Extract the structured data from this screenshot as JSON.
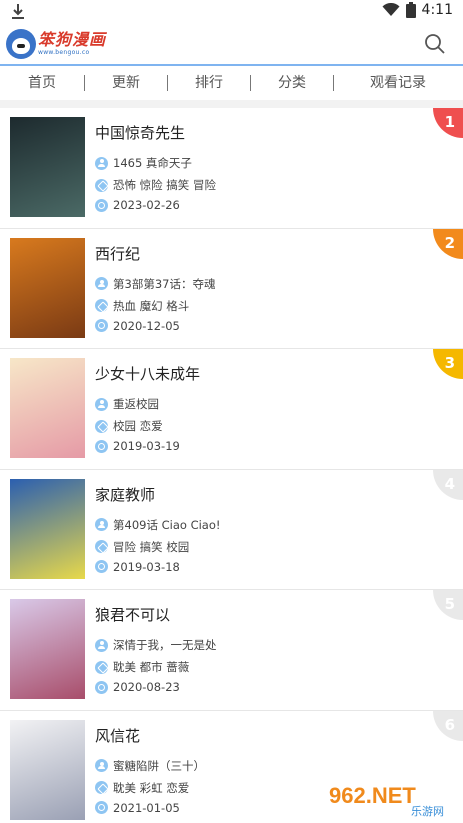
{
  "status_bar": {
    "time": "4:11"
  },
  "header": {
    "logo_name": "笨狗漫画",
    "logo_url": "www.bengou.co"
  },
  "nav": {
    "tabs": [
      {
        "label": "首页"
      },
      {
        "label": "更新"
      },
      {
        "label": "排行"
      },
      {
        "label": "分类"
      },
      {
        "label": "观看记录"
      }
    ]
  },
  "comics": [
    {
      "rank": "1",
      "rank_color": "#ef4f4f",
      "title": "中国惊奇先生",
      "author": "1465 真命天子",
      "tags": "恐怖 惊险 搞笑 冒险",
      "date": "2023-02-26",
      "cover_colors": [
        "#1d2a2e",
        "#4b6a66"
      ]
    },
    {
      "rank": "2",
      "rank_color": "#f28a1c",
      "title": "西行纪",
      "author": "第3部第37话：夺魂",
      "tags": "热血 魔幻 格斗",
      "date": "2020-12-05",
      "cover_colors": [
        "#d87a1e",
        "#7a3a14"
      ]
    },
    {
      "rank": "3",
      "rank_color": "#f5b800",
      "title": "少女十八未成年",
      "author": "重返校园",
      "tags": "校园 恋爱",
      "date": "2019-03-19",
      "cover_colors": [
        "#f7e7c8",
        "#e59aa6"
      ]
    },
    {
      "rank": "4",
      "rank_color": "#e9e9e9",
      "title": "家庭教师",
      "author": "第409话 Ciao Ciao!",
      "tags": "冒险 搞笑 校园",
      "date": "2019-03-18",
      "cover_colors": [
        "#2b5fb0",
        "#e8d94a"
      ]
    },
    {
      "rank": "5",
      "rank_color": "#e9e9e9",
      "title": "狼君不可以",
      "author": "深情于我，一无是处",
      "tags": "耽美 都市 蔷薇",
      "date": "2020-08-23",
      "cover_colors": [
        "#d9c9e8",
        "#a84d6a"
      ]
    },
    {
      "rank": "6",
      "rank_color": "#e9e9e9",
      "title": "风信花",
      "author": "蜜糖陷阱（三十）",
      "tags": "耽美 彩虹 恋爱",
      "date": "2021-01-05",
      "cover_colors": [
        "#f2f2f4",
        "#9aa0b4"
      ]
    }
  ],
  "watermark": {
    "text": "962.NET",
    "subtext": "乐游网"
  }
}
